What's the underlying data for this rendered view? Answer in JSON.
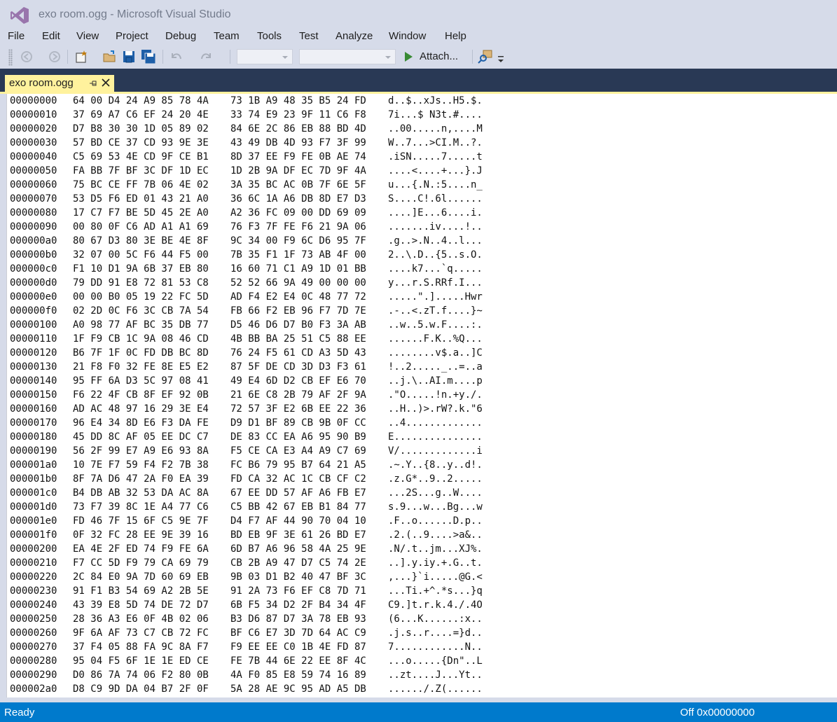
{
  "window": {
    "title": "exo room.ogg - Microsoft Visual Studio"
  },
  "menu": [
    "File",
    "Edit",
    "View",
    "Project",
    "Debug",
    "Team",
    "Tools",
    "Test",
    "Analyze",
    "Window",
    "Help"
  ],
  "toolbar": {
    "attach_label": "Attach...",
    "solution_config_value": "",
    "solution_platform_value": ""
  },
  "tabs": [
    {
      "label": "exo room.ogg"
    }
  ],
  "status": {
    "left": "Ready",
    "right": "Off 0x00000000"
  },
  "colors": {
    "status_bar": "#007acc",
    "active_tab": "#fff29d",
    "tab_well": "#293955",
    "chrome": "#d6dbe9"
  },
  "hex_rows": [
    {
      "addr": "00000000",
      "hex1": "64 00 D4 24 A9 85 78 4A",
      "hex2": "73 1B A9 48 35 B5 24 FD",
      "ascii": "d..$..xJs..H5.$."
    },
    {
      "addr": "00000010",
      "hex1": "37 69 A7 C6 EF 24 20 4E",
      "hex2": "33 74 E9 23 9F 11 C6 F8",
      "ascii": "7i...$ N3t.#...."
    },
    {
      "addr": "00000020",
      "hex1": "D7 B8 30 30 1D 05 89 02",
      "hex2": "84 6E 2C 86 EB 88 BD 4D",
      "ascii": "..00.....n,....M"
    },
    {
      "addr": "00000030",
      "hex1": "57 BD CE 37 CD 93 9E 3E",
      "hex2": "43 49 DB 4D 93 F7 3F 99",
      "ascii": "W..7...>CI.M..?."
    },
    {
      "addr": "00000040",
      "hex1": "C5 69 53 4E CD 9F CE B1",
      "hex2": "8D 37 EE F9 FE 0B AE 74",
      "ascii": ".iSN.....7.....t"
    },
    {
      "addr": "00000050",
      "hex1": "FA BB 7F BF 3C DF 1D EC",
      "hex2": "1D 2B 9A DF EC 7D 9F 4A",
      "ascii": "....<....+...}.J"
    },
    {
      "addr": "00000060",
      "hex1": "75 BC CE FF 7B 06 4E 02",
      "hex2": "3A 35 BC AC 0B 7F 6E 5F",
      "ascii": "u...{.N.:5....n_"
    },
    {
      "addr": "00000070",
      "hex1": "53 D5 F6 ED 01 43 21 A0",
      "hex2": "36 6C 1A A6 DB 8D E7 D3",
      "ascii": "S....C!.6l......"
    },
    {
      "addr": "00000080",
      "hex1": "17 C7 F7 BE 5D 45 2E A0",
      "hex2": "A2 36 FC 09 00 DD 69 09",
      "ascii": "....]E...6....i."
    },
    {
      "addr": "00000090",
      "hex1": "00 80 0F C6 AD A1 A1 69",
      "hex2": "76 F3 7F FE F6 21 9A 06",
      "ascii": ".......iv....!.."
    },
    {
      "addr": "000000a0",
      "hex1": "80 67 D3 80 3E BE 4E 8F",
      "hex2": "9C 34 00 F9 6C D6 95 7F",
      "ascii": ".g..>.N..4..l..."
    },
    {
      "addr": "000000b0",
      "hex1": "32 07 00 5C F6 44 F5 00",
      "hex2": "7B 35 F1 1F 73 AB 4F 00",
      "ascii": "2..\\.D..{5..s.O."
    },
    {
      "addr": "000000c0",
      "hex1": "F1 10 D1 9A 6B 37 EB 80",
      "hex2": "16 60 71 C1 A9 1D 01 BB",
      "ascii": "....k7...`q....."
    },
    {
      "addr": "000000d0",
      "hex1": "79 DD 91 E8 72 81 53 C8",
      "hex2": "52 52 66 9A 49 00 00 00",
      "ascii": "y...r.S.RRf.I..."
    },
    {
      "addr": "000000e0",
      "hex1": "00 00 B0 05 19 22 FC 5D",
      "hex2": "AD F4 E2 E4 0C 48 77 72",
      "ascii": ".....\".].....Hwr"
    },
    {
      "addr": "000000f0",
      "hex1": "02 2D 0C F6 3C CB 7A 54",
      "hex2": "FB 66 F2 EB 96 F7 7D 7E",
      "ascii": ".-..<.zT.f....}~"
    },
    {
      "addr": "00000100",
      "hex1": "A0 98 77 AF BC 35 DB 77",
      "hex2": "D5 46 D6 D7 B0 F3 3A AB",
      "ascii": "..w..5.w.F....:."
    },
    {
      "addr": "00000110",
      "hex1": "1F F9 CB 1C 9A 08 46 CD",
      "hex2": "4B BB BA 25 51 C5 88 EE",
      "ascii": "......F.K..%Q..."
    },
    {
      "addr": "00000120",
      "hex1": "B6 7F 1F 0C FD DB BC 8D",
      "hex2": "76 24 F5 61 CD A3 5D 43",
      "ascii": "........v$.a..]C"
    },
    {
      "addr": "00000130",
      "hex1": "21 F8 F0 32 FE 8E E5 E2",
      "hex2": "87 5F DE CD 3D D3 F3 61",
      "ascii": "!..2....._..=..a"
    },
    {
      "addr": "00000140",
      "hex1": "95 FF 6A D3 5C 97 08 41",
      "hex2": "49 E4 6D D2 CB EF E6 70",
      "ascii": "..j.\\..AI.m....p"
    },
    {
      "addr": "00000150",
      "hex1": "F6 22 4F CB 8F EF 92 0B",
      "hex2": "21 6E C8 2B 79 AF 2F 9A",
      "ascii": ".\"O.....!n.+y./."
    },
    {
      "addr": "00000160",
      "hex1": "AD AC 48 97 16 29 3E E4",
      "hex2": "72 57 3F E2 6B EE 22 36",
      "ascii": "..H..)>.rW?.k.\"6"
    },
    {
      "addr": "00000170",
      "hex1": "96 E4 34 8D E6 F3 DA FE",
      "hex2": "D9 D1 BF 89 CB 9B 0F CC",
      "ascii": "..4............."
    },
    {
      "addr": "00000180",
      "hex1": "45 DD 8C AF 05 EE DC C7",
      "hex2": "DE 83 CC EA A6 95 90 B9",
      "ascii": "E..............."
    },
    {
      "addr": "00000190",
      "hex1": "56 2F 99 E7 A9 E6 93 8A",
      "hex2": "F5 CE CA E3 A4 A9 C7 69",
      "ascii": "V/.............i"
    },
    {
      "addr": "000001a0",
      "hex1": "10 7E F7 59 F4 F2 7B 38",
      "hex2": "FC B6 79 95 B7 64 21 A5",
      "ascii": ".~.Y..{8..y..d!."
    },
    {
      "addr": "000001b0",
      "hex1": "8F 7A D6 47 2A F0 EA 39",
      "hex2": "FD CA 32 AC 1C CB CF C2",
      "ascii": ".z.G*..9..2....."
    },
    {
      "addr": "000001c0",
      "hex1": "B4 DB AB 32 53 DA AC 8A",
      "hex2": "67 EE DD 57 AF A6 FB E7",
      "ascii": "...2S...g..W...."
    },
    {
      "addr": "000001d0",
      "hex1": "73 F7 39 8C 1E A4 77 C6",
      "hex2": "C5 BB 42 67 EB B1 84 77",
      "ascii": "s.9...w...Bg...w"
    },
    {
      "addr": "000001e0",
      "hex1": "FD 46 7F 15 6F C5 9E 7F",
      "hex2": "D4 F7 AF 44 90 70 04 10",
      "ascii": ".F..o......D.p.."
    },
    {
      "addr": "000001f0",
      "hex1": "0F 32 FC 28 EE 9E 39 16",
      "hex2": "BD EB 9F 3E 61 26 BD E7",
      "ascii": ".2.(..9....>a&.."
    },
    {
      "addr": "00000200",
      "hex1": "EA 4E 2F ED 74 F9 FE 6A",
      "hex2": "6D B7 A6 96 58 4A 25 9E",
      "ascii": ".N/.t..jm...XJ%."
    },
    {
      "addr": "00000210",
      "hex1": "F7 CC 5D F9 79 CA 69 79",
      "hex2": "CB 2B A9 47 D7 C5 74 2E",
      "ascii": "..].y.iy.+.G..t."
    },
    {
      "addr": "00000220",
      "hex1": "2C 84 E0 9A 7D 60 69 EB",
      "hex2": "9B 03 D1 B2 40 47 BF 3C",
      "ascii": ",...}`i.....@G.<"
    },
    {
      "addr": "00000230",
      "hex1": "91 F1 B3 54 69 A2 2B 5E",
      "hex2": "91 2A 73 F6 EF C8 7D 71",
      "ascii": "...Ti.+^.*s...}q"
    },
    {
      "addr": "00000240",
      "hex1": "43 39 E8 5D 74 DE 72 D7",
      "hex2": "6B F5 34 D2 2F B4 34 4F",
      "ascii": "C9.]t.r.k.4./.4O"
    },
    {
      "addr": "00000250",
      "hex1": "28 36 A3 E6 0F 4B 02 06",
      "hex2": "B3 D6 87 D7 3A 78 EB 93",
      "ascii": "(6...K......:x.."
    },
    {
      "addr": "00000260",
      "hex1": "9F 6A AF 73 C7 CB 72 FC",
      "hex2": "BF C6 E7 3D 7D 64 AC C9",
      "ascii": ".j.s..r....=}d.."
    },
    {
      "addr": "00000270",
      "hex1": "37 F4 05 88 FA 9C 8A F7",
      "hex2": "F9 EE EE C0 1B 4E FD 87",
      "ascii": "7............N.."
    },
    {
      "addr": "00000280",
      "hex1": "95 04 F5 6F 1E 1E ED CE",
      "hex2": "FE 7B 44 6E 22 EE 8F 4C",
      "ascii": "...o.....{Dn\"..L"
    },
    {
      "addr": "00000290",
      "hex1": "D0 86 7A 74 06 F2 80 0B",
      "hex2": "4A F0 85 E8 59 74 16 89",
      "ascii": "..zt....J...Yt.."
    },
    {
      "addr": "000002a0",
      "hex1": "D8 C9 9D DA 04 B7 2F 0F",
      "hex2": "5A 28 AE 9C 95 AD A5 DB",
      "ascii": "....../.Z(......"
    }
  ]
}
